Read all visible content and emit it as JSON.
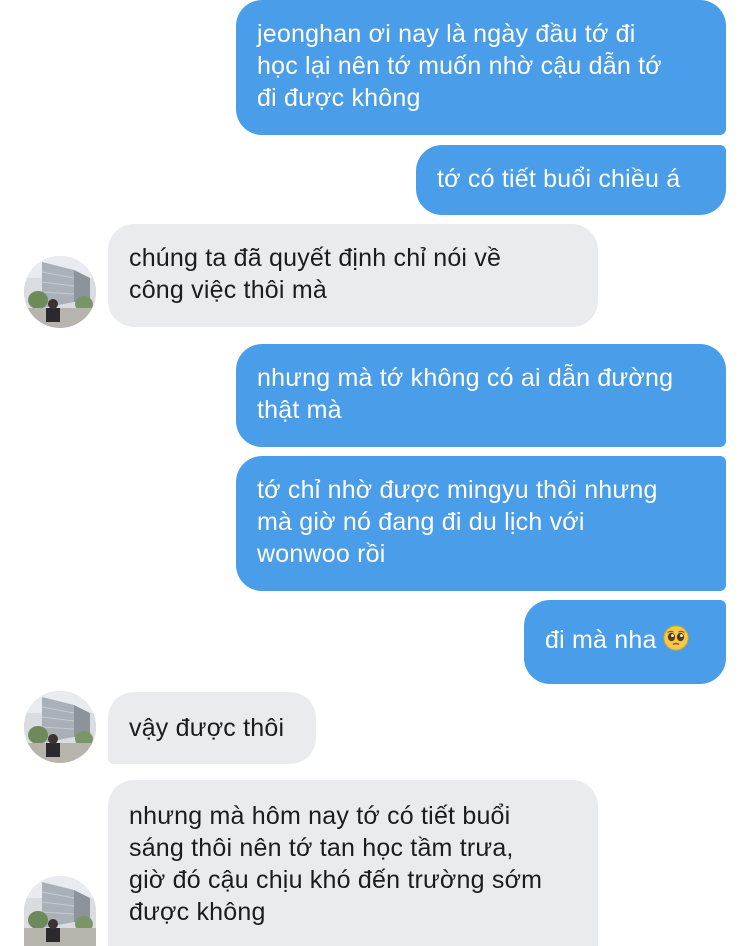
{
  "conversation": {
    "messages": [
      {
        "sender": "me",
        "lines": [
          "jeonghan ơi nay là ngày đầu tớ đi",
          "học lại nên tớ muốn nhờ cậu dẫn tớ",
          "đi được không"
        ]
      },
      {
        "sender": "me",
        "lines": [
          "tớ có tiết buổi chiều á"
        ]
      },
      {
        "sender": "other",
        "lines": [
          "chúng ta đã quyết định chỉ nói về",
          "công việc thôi mà"
        ]
      },
      {
        "sender": "me",
        "lines": [
          "nhưng mà tớ không có ai dẫn đường",
          "thật mà"
        ]
      },
      {
        "sender": "me",
        "lines": [
          "tớ chỉ nhờ được mingyu thôi nhưng",
          "mà giờ nó đang đi du lịch với",
          "wonwoo rồi"
        ]
      },
      {
        "sender": "me",
        "lines": [
          "đi mà nha"
        ],
        "emoji": "pleading-face-emoji"
      },
      {
        "sender": "other",
        "lines": [
          "vậy được thôi"
        ]
      },
      {
        "sender": "other",
        "lines": [
          "nhưng mà hôm nay tớ có tiết buổi",
          "sáng thôi nên tớ tan học tầm trưa,",
          "giờ đó cậu chịu khó đến trường sớm",
          "được không"
        ]
      }
    ]
  },
  "colors": {
    "sent_bubble": "#4a9de8",
    "received_bubble": "#e9ebef",
    "sent_text": "#ffffff",
    "received_text": "#1c1c1e"
  }
}
